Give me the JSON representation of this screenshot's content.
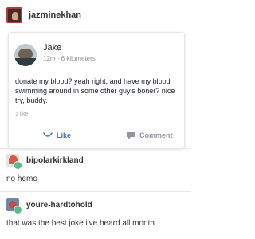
{
  "post": {
    "username": "jazminekhan"
  },
  "card": {
    "author": "Jake",
    "meta": "12m · 6 kilometers",
    "text": "donate my blood? yeah right, and have my blood swimming around in some other guy's boner? nice try, buddy.",
    "likes": "1 like",
    "like_label": "Like",
    "comment_label": "Comment"
  },
  "reblogs": [
    {
      "username": "bipolarkirkland",
      "text": "no hemo"
    },
    {
      "username": "youre-hardtohold",
      "text": "that was the best joke i've heard all month"
    }
  ],
  "colors": {
    "like_blue": "#4b73b8",
    "muted_gray": "#90949c",
    "badge_green": "#56bc8a"
  },
  "icons": {
    "like": "smile-like-icon",
    "comment": "speech-bubble-icon",
    "reblog_badge": "reblog-badge-icon"
  }
}
